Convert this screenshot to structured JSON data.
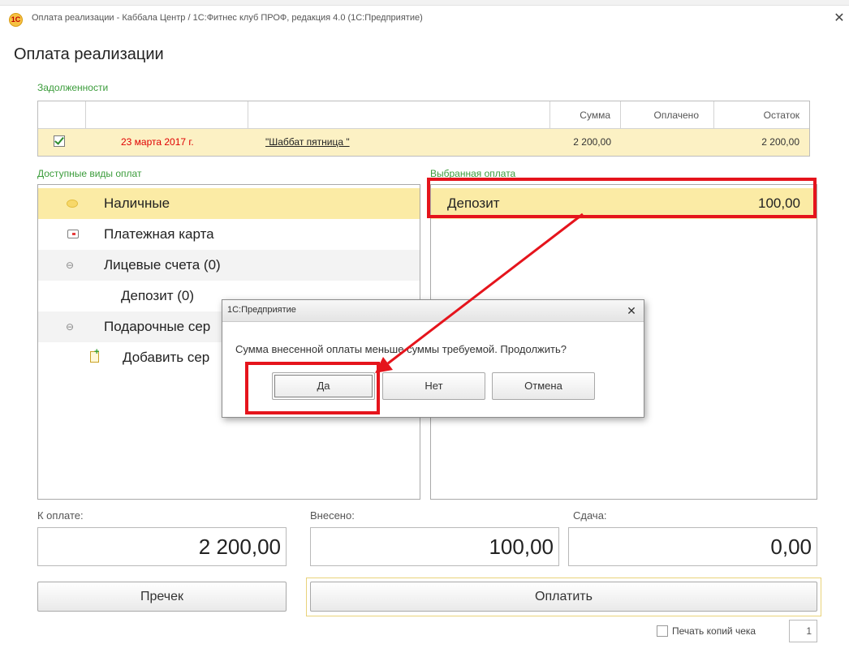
{
  "window": {
    "title": "Оплата реализации - Каббала Центр / 1С:Фитнес клуб ПРОФ, редакция 4.0  (1С:Предприятие)",
    "close_glyph": "✕",
    "logo_glyph": "1С"
  },
  "page_title": "Оплата реализации",
  "debts": {
    "title": "Задолженности",
    "columns": {
      "amount": "Сумма",
      "paid": "Оплачено",
      "balance": "Остаток"
    },
    "rows": [
      {
        "checked": true,
        "date": "23 марта 2017 г.",
        "name": "\"Шаббат пятница \"",
        "amount": "2 200,00",
        "paid": "",
        "balance": "2 200,00"
      }
    ]
  },
  "methods": {
    "title": "Доступные виды оплат",
    "items": [
      {
        "label": "Наличные",
        "icon": "coin-icon",
        "selected": true
      },
      {
        "label": "Платежная карта",
        "icon": "card-icon"
      },
      {
        "label": "Лицевые счета (0)",
        "icon": "collapse-icon"
      },
      {
        "label": "Депозит  (0)",
        "icon": ""
      },
      {
        "label": "Подарочные сер",
        "icon": "collapse-icon"
      },
      {
        "label": "Добавить сер",
        "icon": "add-document-icon"
      }
    ]
  },
  "selected_payment": {
    "title": "Выбранная оплата",
    "name": "Депозит",
    "amount": "100,00"
  },
  "totals": {
    "to_pay_label": "К оплате:",
    "to_pay_value": "2 200,00",
    "paid_label": "Внесено:",
    "paid_value": "100,00",
    "change_label": "Сдача:",
    "change_value": "0,00"
  },
  "buttons": {
    "precheck": "Пречек",
    "pay": "Оплатить"
  },
  "copies": {
    "label": "Печать копий чека",
    "checked": false,
    "value": "1"
  },
  "dialog": {
    "title": "1С:Предприятие",
    "close_glyph": "✕",
    "message": "Сумма внесенной оплаты меньше суммы требуемой. Продолжить?",
    "yes": "Да",
    "no": "Нет",
    "cancel": "Отмена"
  },
  "colors": {
    "accent_highlight": "#e5141c",
    "selection": "#fbeba5",
    "section_title": "#3b9c3b",
    "date_text": "#e00000"
  }
}
